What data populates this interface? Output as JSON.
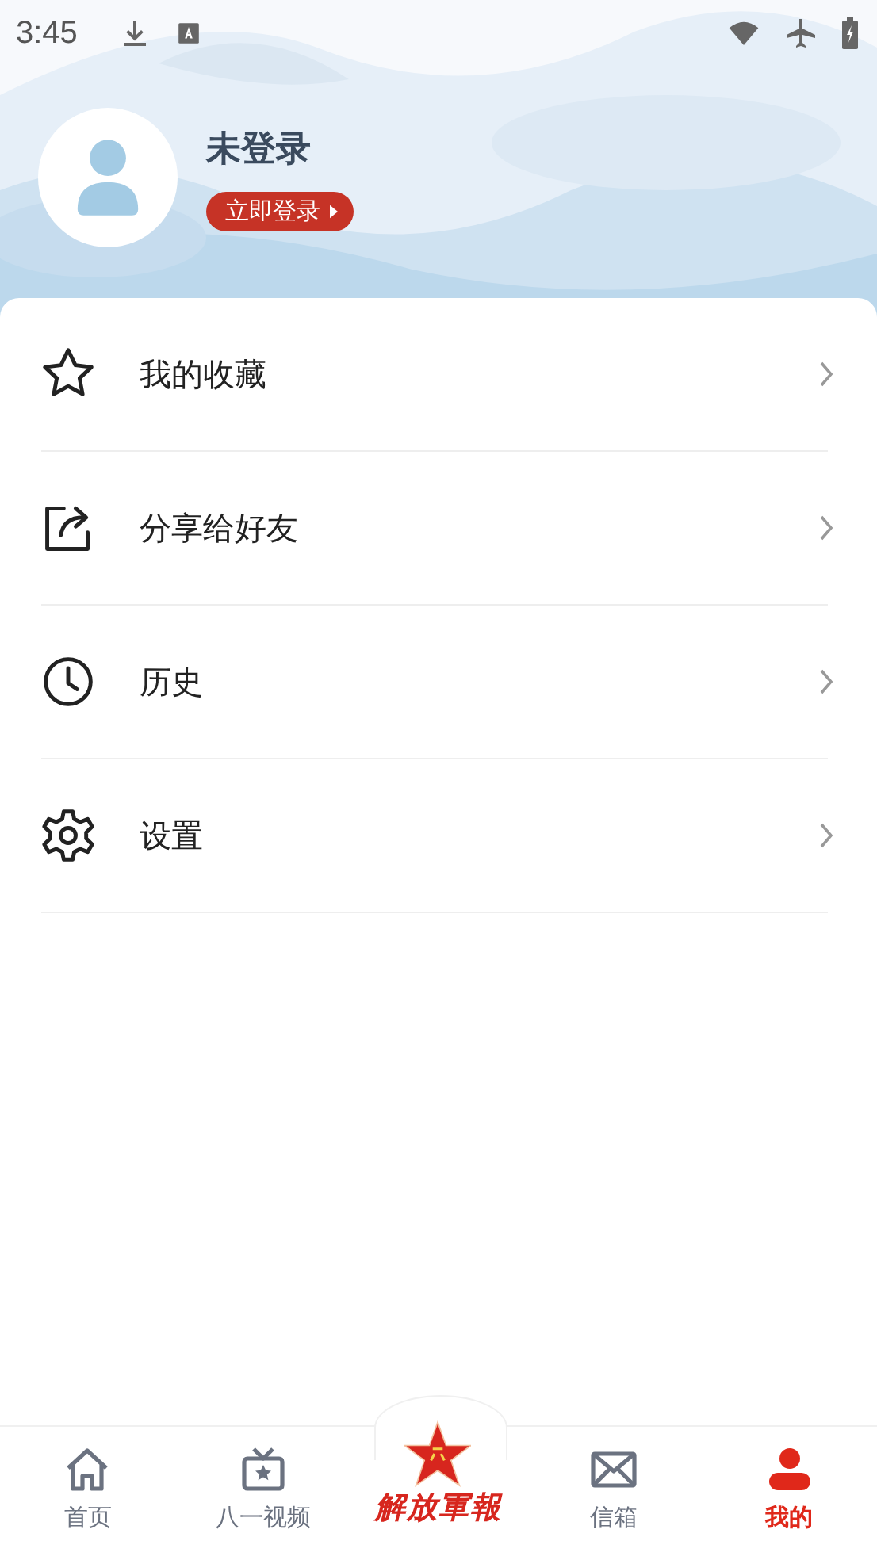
{
  "status_bar": {
    "time": "3:45"
  },
  "profile": {
    "name": "未登录",
    "login_button": "立即登录"
  },
  "menu": [
    {
      "kind": "star",
      "label": "我的收藏"
    },
    {
      "kind": "share",
      "label": "分享给好友"
    },
    {
      "kind": "clock",
      "label": "历史"
    },
    {
      "kind": "gear",
      "label": "设置"
    }
  ],
  "nav": [
    {
      "kind": "home",
      "label": "首页",
      "selected": false
    },
    {
      "kind": "tv",
      "label": "八一视频",
      "selected": false
    },
    {
      "kind": "logo",
      "label": "解放軍報",
      "selected": false
    },
    {
      "kind": "mail",
      "label": "信箱",
      "selected": false
    },
    {
      "kind": "person",
      "label": "我的",
      "selected": true
    }
  ]
}
